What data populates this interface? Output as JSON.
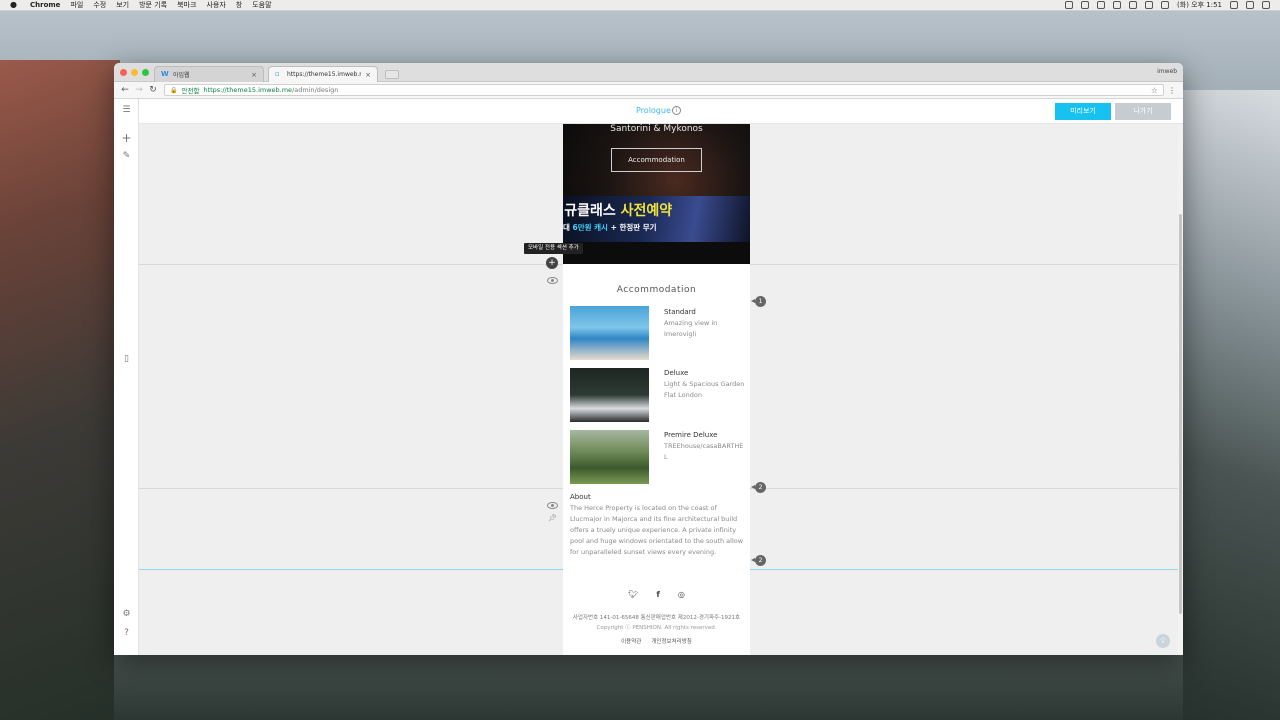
{
  "menubar": {
    "app": "Chrome",
    "items": [
      "파일",
      "수정",
      "보기",
      "방문 기록",
      "북마크",
      "사용자",
      "창",
      "도움말"
    ],
    "clock": "(화) 오후 1:51"
  },
  "browser": {
    "tabs": [
      {
        "title": "아임웹",
        "favicon": "W"
      },
      {
        "title": "https://theme15.imweb.me/ad"
      }
    ],
    "profile": "imweb",
    "address": {
      "secure_label": "안전함",
      "host": "https://theme15.imweb.me",
      "path": "/admin/design"
    }
  },
  "editor": {
    "page_name": "Prologue",
    "info_icon": "i",
    "preview_button": "미리보기",
    "exit_button": "나가기",
    "tooltip": "모바일 전용 섹션 추가",
    "badges": [
      "1",
      "2",
      "2"
    ]
  },
  "site": {
    "hero": {
      "title": "Santorini & Mykonos",
      "button": "Accommodation"
    },
    "banner": {
      "line1_a": "I규클래스 ",
      "line1_b": "사전예약",
      "line2_a": "대 ",
      "line2_b": "6만원 캐시",
      "line2_c": " + 한정판 무기"
    },
    "accommodation": {
      "title": "Accommodation",
      "rooms": [
        {
          "name": "Standard",
          "desc": "Amazing view in Imerovigli"
        },
        {
          "name": "Deluxe",
          "desc": "Light & Spacious Garden Flat London"
        },
        {
          "name": "Premire Deluxe",
          "desc": "TREEhouse/casaBARTHEL"
        }
      ]
    },
    "about": {
      "title": "About",
      "text": "The Herce Property is located on the coast of Llucmajor in Majorca and its fine architectural build offers a truely unique experience. A private infinity pool and huge windows orientated to the south allow for unparalleled sunset views every evening."
    },
    "footer": {
      "social": [
        "twitter-icon",
        "facebook-icon",
        "instagram-icon"
      ],
      "biz": "사업자번호 141-01-65648   통신판매업번호 제2012-경기파주-1921호",
      "copyright": "Copyright ⓒ PENSHION. All rights reserved.",
      "links": [
        "이용약관",
        "개인정보처리방침"
      ]
    }
  }
}
